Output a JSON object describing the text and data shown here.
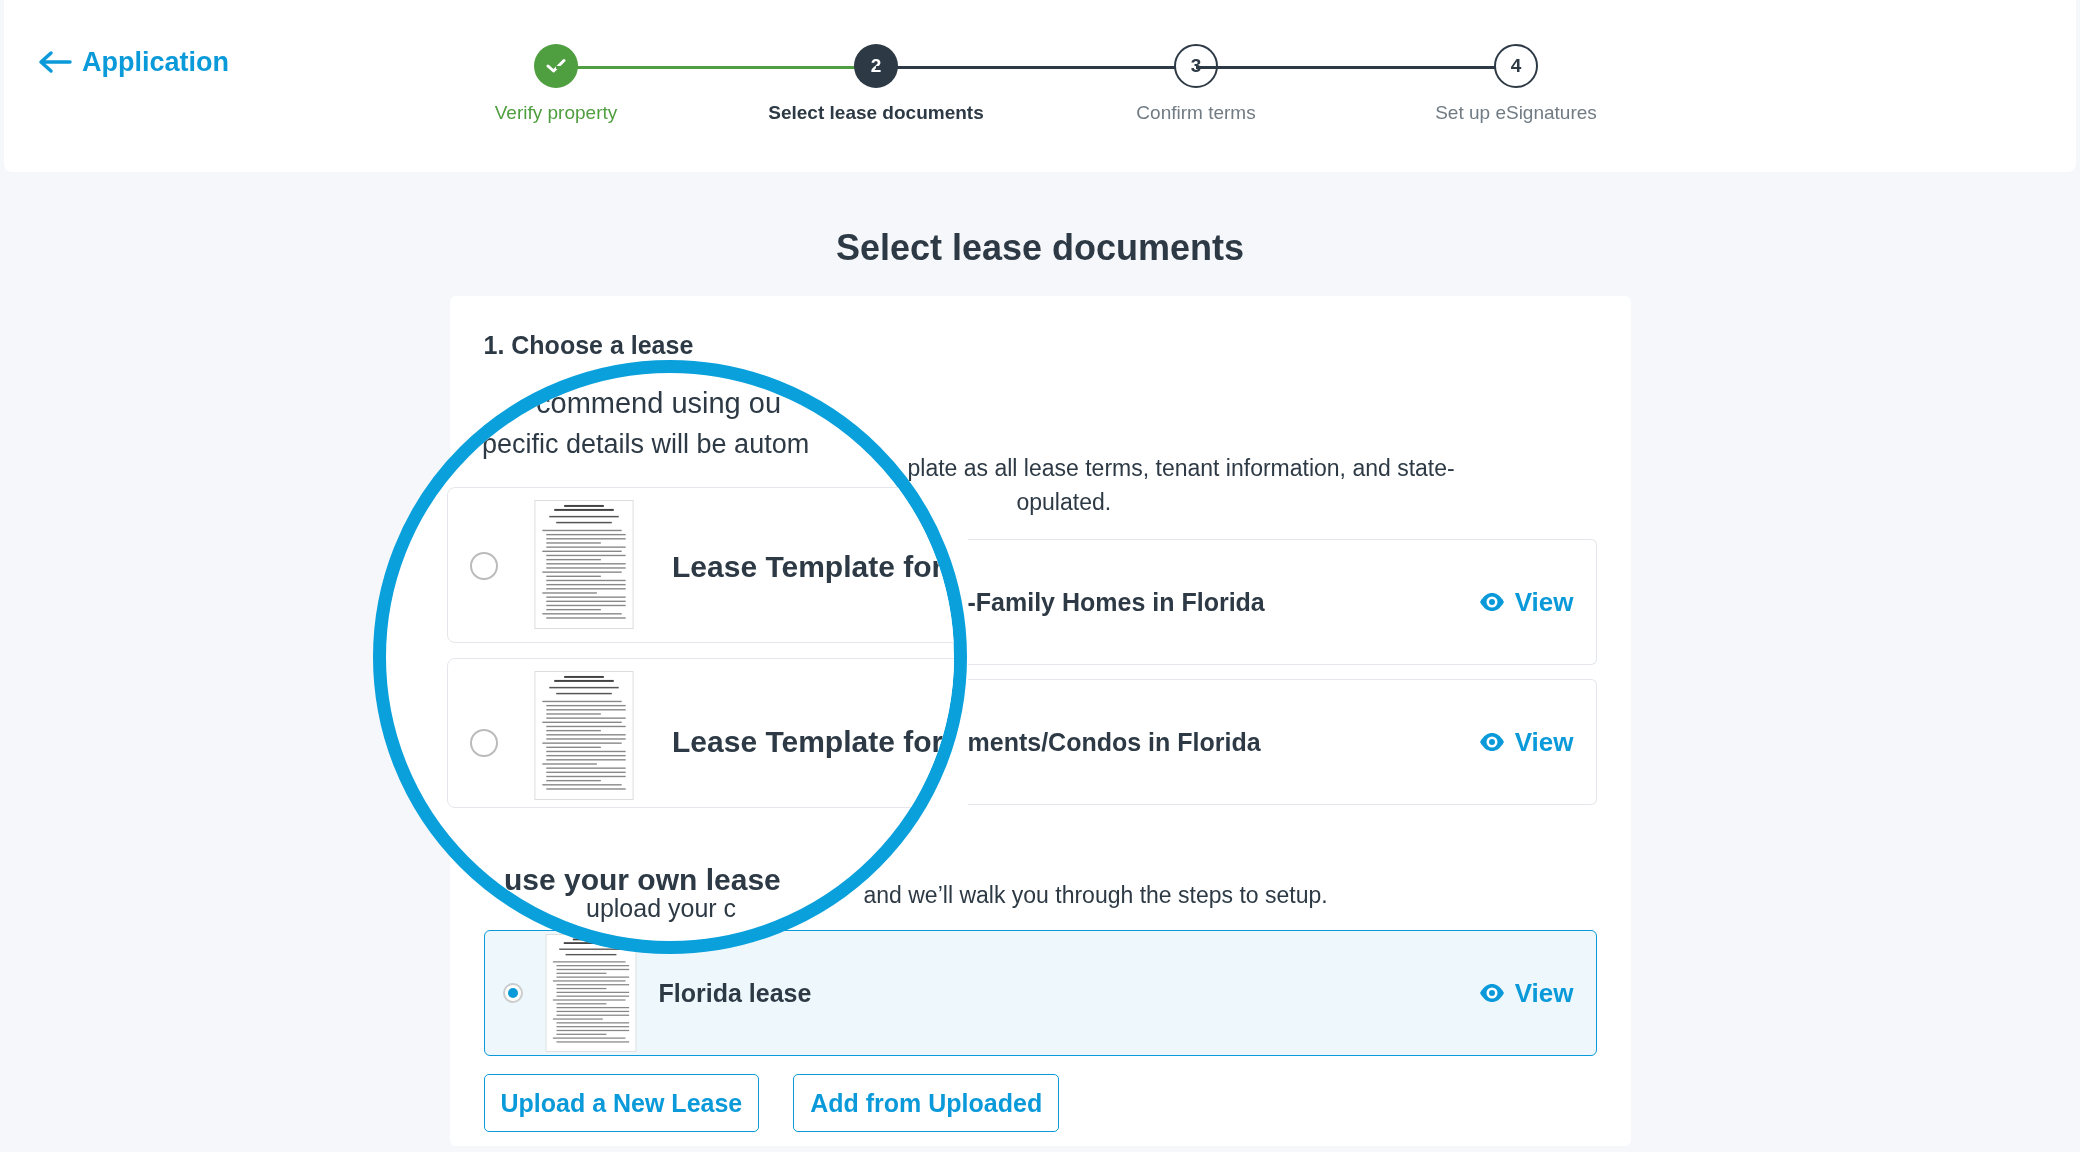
{
  "back_link": {
    "label": "Application"
  },
  "steps": [
    {
      "label": "Verify property",
      "done": true,
      "selected": false
    },
    {
      "label": "Select lease documents",
      "number": "2",
      "done": false,
      "selected": true
    },
    {
      "label": "Confirm terms",
      "number": "3",
      "done": false,
      "selected": false
    },
    {
      "label": "Set up eSignatures",
      "number": "4",
      "done": false,
      "selected": false
    }
  ],
  "title": "Select lease documents",
  "section_1": {
    "heading": "1. Choose a lease",
    "description_lines": [
      "plate as all lease terms, tenant information, and state-",
      "opulated."
    ],
    "templates": [
      {
        "name": "-Family Homes in Florida",
        "action": "View"
      },
      {
        "name": "ments/Condos in Florida",
        "action": "View"
      }
    ]
  },
  "section_2": {
    "description": "and we’ll walk you through the steps to setup.",
    "leases": [
      {
        "name": "Florida lease",
        "selected": true,
        "action": "View"
      }
    ],
    "buttons": [
      "Upload a New Lease",
      "Add from Uploaded"
    ]
  },
  "magnifier": {
    "description_lines": [
      "commend using ou",
      "pecific details will be autom"
    ],
    "templates": [
      {
        "name": "Lease Template for",
        "selected": false
      },
      {
        "name": "Lease Template for",
        "selected": false
      }
    ],
    "section_2_heading": "use your own lease",
    "section_2_description": "upload your c"
  }
}
